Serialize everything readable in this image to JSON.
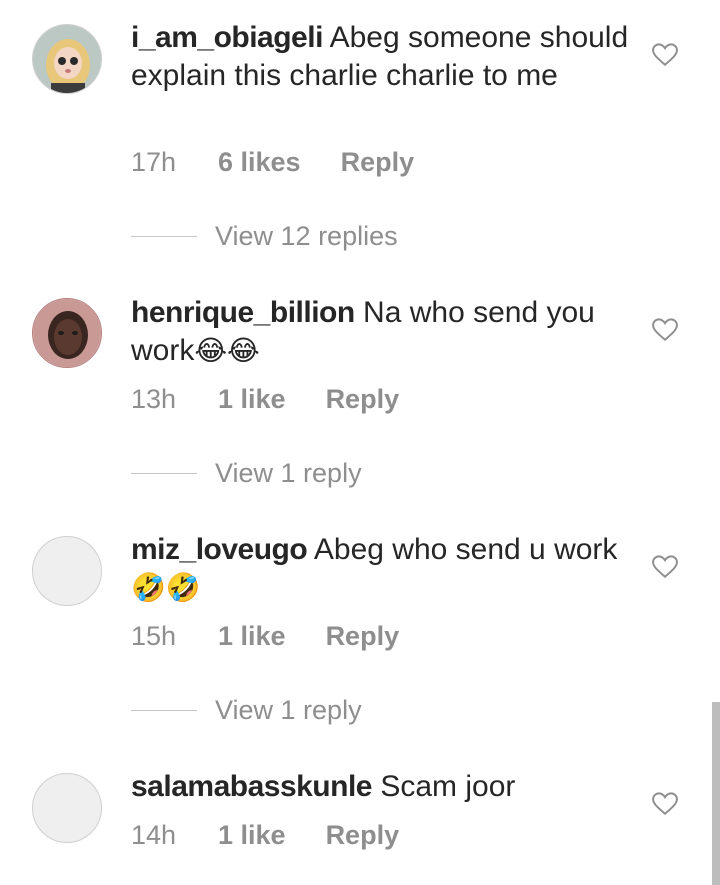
{
  "comments": [
    {
      "username": "i_am_obiageli",
      "text": "Abeg someone should explain this charlie charlie to me",
      "time": "17h",
      "likes": "6 likes",
      "reply": "Reply",
      "view_replies": "View 12 replies",
      "avatar": "photo-avatar-cartoon-girl"
    },
    {
      "username": "henrique_billion",
      "text": "Na who send you work",
      "emoji": "😂😂",
      "time": "13h",
      "likes": "1 like",
      "reply": "Reply",
      "view_replies": "View 1 reply",
      "avatar": "photo-avatar-portrait"
    },
    {
      "username": "miz_loveugo",
      "text": "Abeg who send u work",
      "emoji": "🤣🤣",
      "time": "15h",
      "likes": "1 like",
      "reply": "Reply",
      "view_replies": "View 1 reply",
      "avatar": "default-avatar"
    },
    {
      "username": "salamabasskunle",
      "text": "Scam joor",
      "time": "14h",
      "likes": "1 like",
      "reply": "Reply",
      "avatar": "default-avatar"
    }
  ],
  "colors": {
    "text": "#262626",
    "secondary": "#8e8e8e",
    "divider": "#c7c7c7",
    "avatar_placeholder": "#efefef"
  }
}
